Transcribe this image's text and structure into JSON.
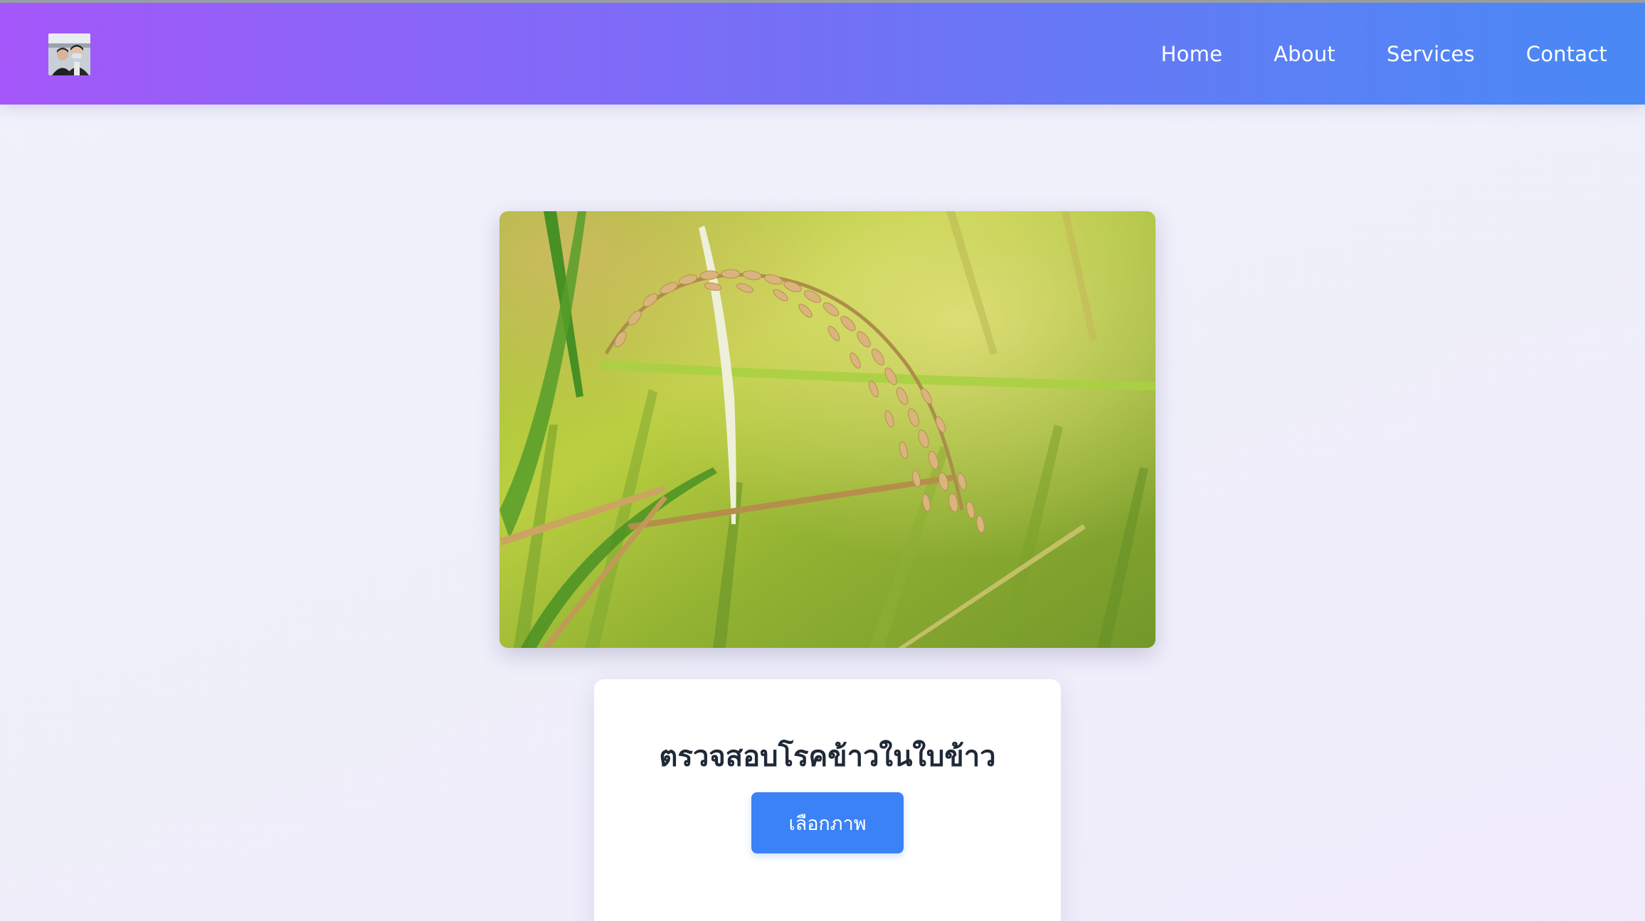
{
  "navbar": {
    "logo_icon": "user-photo-avatar",
    "links": [
      {
        "label": "Home"
      },
      {
        "label": "About"
      },
      {
        "label": "Services"
      },
      {
        "label": "Contact"
      }
    ],
    "gradient": [
      "#a557fa",
      "#4889f5"
    ]
  },
  "hero": {
    "image_icon": "rice-plant-photo"
  },
  "card": {
    "title": "ตรวจสอบโรคข้าวในใบข้าว",
    "choose_image_label": "เลือกภาพ"
  },
  "colors": {
    "accent": "#3b82f6",
    "title_text": "#1f2937",
    "page_bg": "#f0f0fb"
  }
}
